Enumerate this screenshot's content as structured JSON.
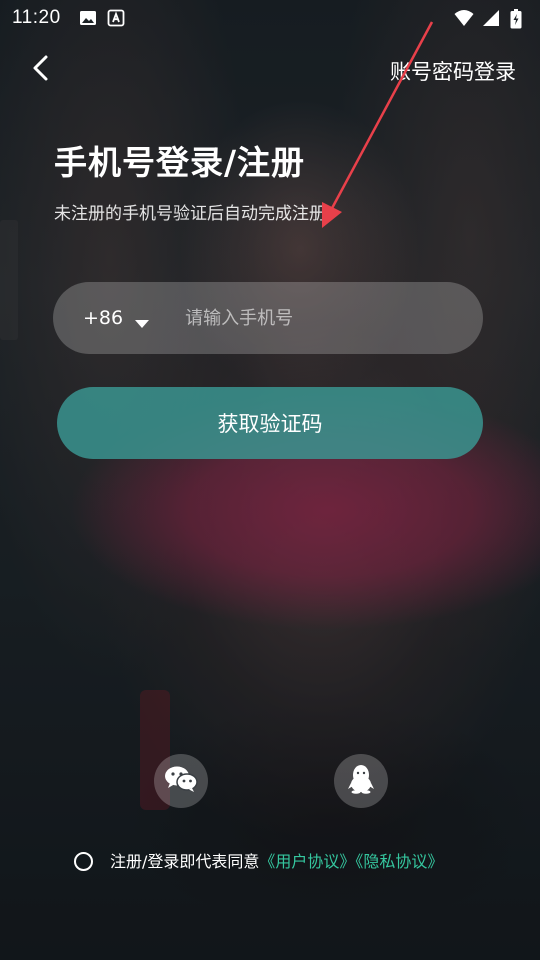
{
  "status_bar": {
    "time": "11:20",
    "left_icons": [
      "image-icon",
      "a-text-icon"
    ],
    "right_icons": [
      "wifi-icon",
      "signal-icon",
      "battery-charging-icon"
    ]
  },
  "header": {
    "back_icon": "back-chevron-icon",
    "account_login_label": "账号密码登录"
  },
  "main": {
    "title": "手机号登录/注册",
    "subtitle": "未注册的手机号验证后自动完成注册",
    "phone": {
      "country_code": "+86",
      "value": "",
      "placeholder": "请输入手机号"
    },
    "get_code_label": "获取验证码"
  },
  "social": {
    "wechat_icon": "wechat-icon",
    "qq_icon": "qq-penguin-icon"
  },
  "agreement": {
    "prefix": "注册/登录即代表同意",
    "user_agreement": "《用户协议》",
    "privacy_policy": "《隐私协议》",
    "checked": false
  },
  "colors": {
    "accent": "#35c79f",
    "button": "#3a9894",
    "annotation_arrow": "#e8404a"
  }
}
